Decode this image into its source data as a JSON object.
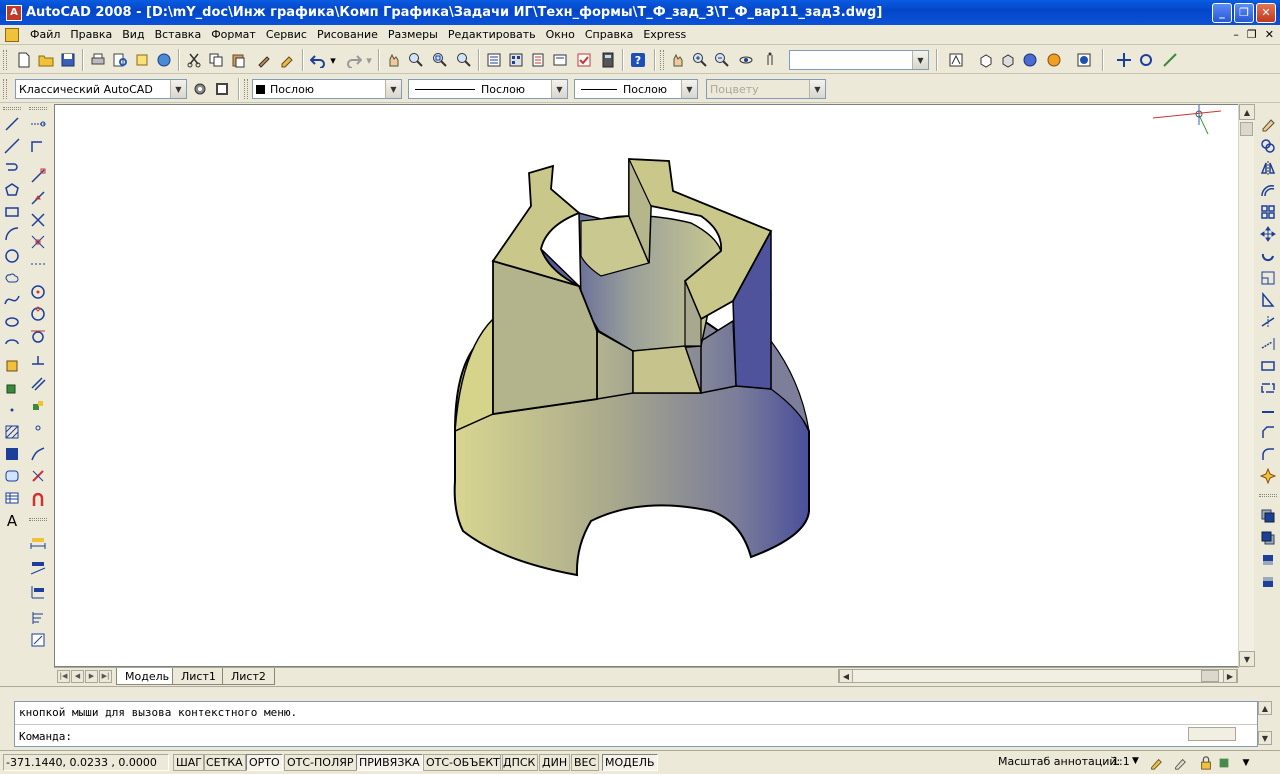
{
  "window": {
    "title": "AutoCAD 2008 - [D:\\mY_doc\\Инж графика\\Комп Графика\\Задачи ИГ\\Техн_формы\\Т_Ф_зад_3\\Т_Ф_вар11_зад3.dwg]"
  },
  "menu": {
    "items": [
      "Файл",
      "Правка",
      "Вид",
      "Вставка",
      "Формат",
      "Сервис",
      "Рисование",
      "Размеры",
      "Редактировать",
      "Окно",
      "Справка",
      "Express"
    ]
  },
  "toolbars": {
    "workspace": "Классический AutoCAD",
    "layer_color": "Послою",
    "linetype": "Послою",
    "lineweight": "Послою",
    "plotstyle": "Поцвету",
    "view_combo": ""
  },
  "layout_tabs": [
    "Модель",
    "Лист1",
    "Лист2"
  ],
  "command": {
    "history": "кнопкой мыши для вызова контекстного меню.",
    "prompt": "Команда:"
  },
  "status": {
    "coords": "-371.1440, 0.0233 , 0.0000",
    "toggles": [
      "ШАГ",
      "СЕТКА",
      "ОРТО",
      "ОТС-ПОЛЯР",
      "ПРИВЯЗКА",
      "ОТС-ОБЪЕКТ",
      "ДПСК",
      "ДИН",
      "ВЕС",
      "МОДЕЛЬ"
    ],
    "toggles_on": [
      "ОРТО",
      "ПРИВЯЗКА",
      "МОДЕЛЬ"
    ],
    "annotation_scale_label": "Масштаб аннотаций:",
    "annotation_scale_value": "1:1"
  },
  "colors": {
    "titlebar": "#0a52d8",
    "model_yellow": "#d6d48a",
    "model_blue": "#4a4f9a",
    "canvas": "#ffffff"
  }
}
